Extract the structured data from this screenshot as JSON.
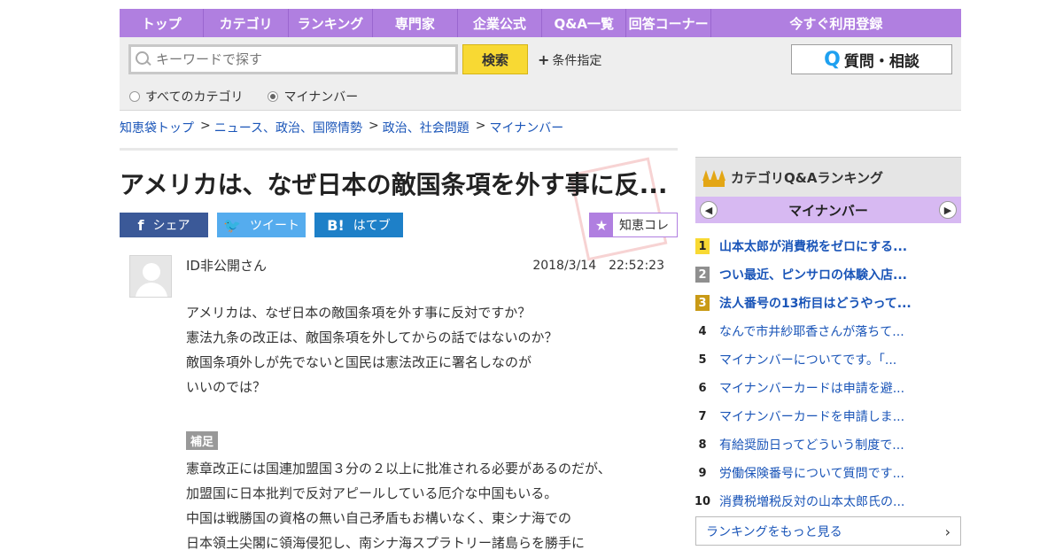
{
  "nav": [
    "トップ",
    "カテゴリ",
    "ランキング",
    "専門家",
    "企業公式",
    "Q&A一覧",
    "回答コーナー",
    "今すぐ利用登録"
  ],
  "search": {
    "placeholder": "キーワードで探す",
    "button": "検索",
    "condition": "条件指定",
    "ask_button": "質問・相談",
    "ask_icon": "Q",
    "radios": [
      {
        "label": "すべてのカテゴリ",
        "selected": false
      },
      {
        "label": "マイナンバー",
        "selected": true
      }
    ]
  },
  "breadcrumb": [
    "知恵袋トップ",
    "ニュース、政治、国際情勢",
    "政治、社会問題",
    "マイナンバー"
  ],
  "breadcrumb_sep": ">",
  "question": {
    "title": "アメリカは、なぜ日本の敵国条項を外す事に反...",
    "share": {
      "facebook": "シェア",
      "twitter": "ツイート",
      "hatena": "はてブ"
    },
    "collection": "知恵コレ",
    "user": "ID非公開さん",
    "date": "2018/3/14　22:52:23",
    "body": [
      "アメリカは、なぜ日本の敵国条項を外す事に反対ですか？",
      "憲法九条の改正は、敵国条項を外してからの話ではないのか？",
      "敵国条項外しが先でないと国民は憲法改正に署名しなのが",
      "いいのでは？"
    ],
    "supplement_label": "補足",
    "supplement": [
      "憲章改正には国連加盟国３分の２以上に批准される必要があるのだが、",
      "加盟国に日本批判で反対アピールしている厄介な中国もいる。",
      "中国は戦勝国の資格の無い自己矛盾もお構いなく、東シナ海での",
      "日本領土尖閣に領海侵犯し、南シナ海スプラトリー諸島らを勝手に"
    ]
  },
  "ranking": {
    "title": "カテゴリQ&Aランキング",
    "category": "マイナンバー",
    "items": [
      "山本太郎が消費税をゼロにする...",
      "つい最近、ピンサロの体験入店...",
      "法人番号の13桁目はどうやって...",
      "なんで市井紗耶香さんが落ちて...",
      "マイナンバーについてです。「...",
      "マイナンバーカードは申請を避...",
      "マイナンバーカードを申請しま...",
      "有給奨励日ってどういう制度で...",
      "労働保険番号について質問です...",
      "消費税増税反対の山本太郎氏の..."
    ],
    "numbers": [
      "1",
      "2",
      "3",
      "4",
      "5",
      "6",
      "7",
      "8",
      "9",
      "10"
    ],
    "more": "ランキングをもっと見る"
  },
  "colors": {
    "nav": "#b07fe0",
    "search_button": "#f8d933",
    "link": "#1a55b8",
    "facebook": "#3b5998",
    "twitter": "#55acee",
    "hatena": "#1e80c8"
  }
}
